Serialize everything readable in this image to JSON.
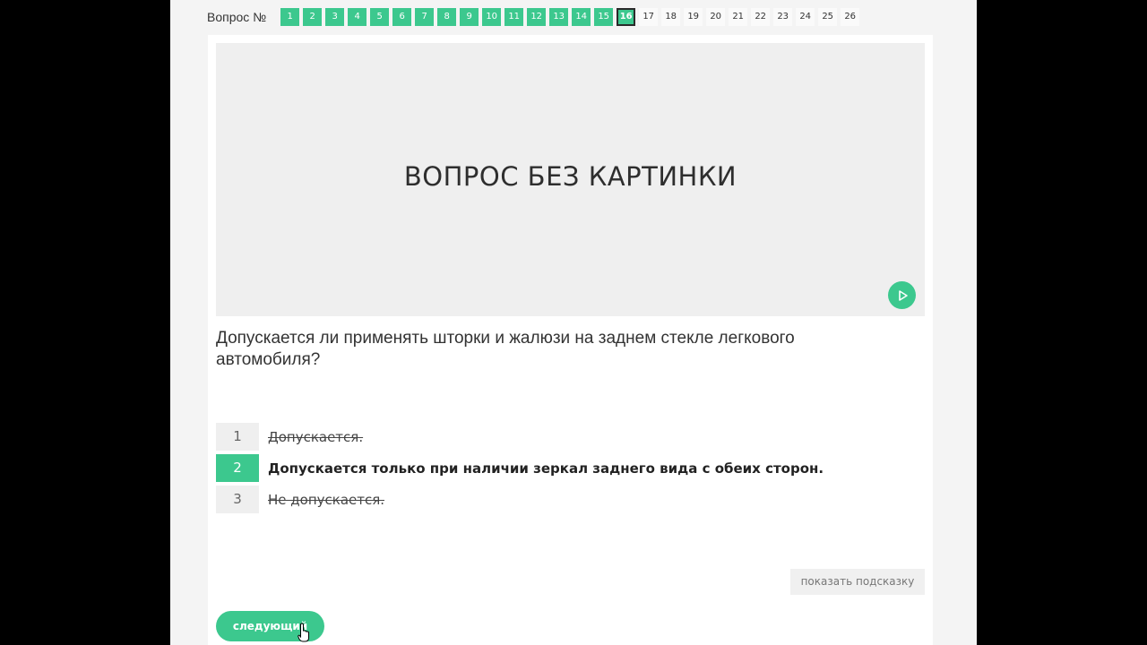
{
  "nav": {
    "label": "Вопрос №",
    "questions": [
      {
        "n": "1",
        "state": "done"
      },
      {
        "n": "2",
        "state": "done"
      },
      {
        "n": "3",
        "state": "done"
      },
      {
        "n": "4",
        "state": "done"
      },
      {
        "n": "5",
        "state": "done"
      },
      {
        "n": "6",
        "state": "done"
      },
      {
        "n": "7",
        "state": "done"
      },
      {
        "n": "8",
        "state": "done"
      },
      {
        "n": "9",
        "state": "done"
      },
      {
        "n": "10",
        "state": "done"
      },
      {
        "n": "11",
        "state": "done"
      },
      {
        "n": "12",
        "state": "done"
      },
      {
        "n": "13",
        "state": "done"
      },
      {
        "n": "14",
        "state": "done"
      },
      {
        "n": "15",
        "state": "done"
      },
      {
        "n": "16",
        "state": "current"
      },
      {
        "n": "17",
        "state": "todo"
      },
      {
        "n": "18",
        "state": "todo"
      },
      {
        "n": "19",
        "state": "todo"
      },
      {
        "n": "20",
        "state": "todo"
      },
      {
        "n": "21",
        "state": "todo"
      },
      {
        "n": "22",
        "state": "todo"
      },
      {
        "n": "23",
        "state": "todo"
      },
      {
        "n": "24",
        "state": "todo"
      },
      {
        "n": "25",
        "state": "todo"
      },
      {
        "n": "26",
        "state": "todo"
      }
    ]
  },
  "image": {
    "text": "ВОПРОС БЕЗ КАРТИНКИ"
  },
  "question": {
    "text": "Допускается ли применять шторки и жалюзи на заднем стекле легкового автомобиля?"
  },
  "answers": [
    {
      "num": "1",
      "text": "Допускается.",
      "state": "wrong"
    },
    {
      "num": "2",
      "text": "Допускается только при наличии зеркал заднего вида с обеих сторон.",
      "state": "right"
    },
    {
      "num": "3",
      "text": "Не допускается.",
      "state": "wrong"
    }
  ],
  "buttons": {
    "hint": "показать подсказку",
    "next": "следующий"
  },
  "icons": {
    "play": "play-icon",
    "cursor": "hand-cursor-icon"
  },
  "colors": {
    "accent": "#3cc88e"
  }
}
